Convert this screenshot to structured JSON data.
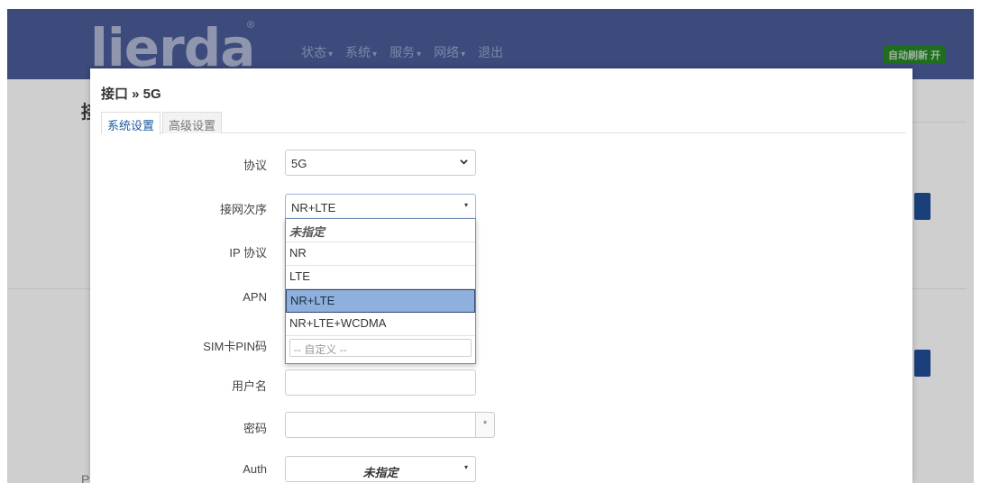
{
  "header": {
    "logo": "lierda",
    "logo_mark": "®",
    "nav": [
      {
        "label": "状态"
      },
      {
        "label": "系统"
      },
      {
        "label": "服务"
      },
      {
        "label": "网络"
      },
      {
        "label": "退出"
      }
    ],
    "nav_caret": "▾",
    "auto_refresh": "自动刷新 开"
  },
  "background": {
    "heading": "接",
    "footer_char": "P"
  },
  "modal": {
    "title": "接口 » 5G",
    "tabs": [
      {
        "label": "系统设置",
        "active": true
      },
      {
        "label": "高级设置",
        "active": false
      }
    ],
    "fields": {
      "protocol": {
        "label": "协议",
        "value": "5G"
      },
      "network_order": {
        "label": "接网次序",
        "value": "NR+LTE"
      },
      "ip_protocol": {
        "label": "IP 协议"
      },
      "apn": {
        "label": "APN"
      },
      "sim_pin": {
        "label": "SIM卡PIN码"
      },
      "username": {
        "label": "用户名",
        "value": ""
      },
      "password": {
        "label": "密码",
        "value": "",
        "reveal": "*"
      },
      "auth": {
        "label": "Auth",
        "value": "未指定"
      }
    },
    "dropdown": {
      "options": [
        {
          "label": "未指定",
          "style": "placeholder"
        },
        {
          "label": "NR"
        },
        {
          "label": "LTE"
        },
        {
          "label": "NR+LTE",
          "selected": true
        },
        {
          "label": "NR+LTE+WCDMA"
        }
      ],
      "custom_placeholder": "-- 自定义 --"
    }
  },
  "colors": {
    "header_bg": "#3c4a7c",
    "accent": "#1a5a9e",
    "selected_option": "#8fb0dc",
    "auto_refresh_bg": "#1e6e1e"
  },
  "icons": {
    "select_chevron": "chevron-down-icon",
    "small_caret": "caret-down-icon"
  }
}
